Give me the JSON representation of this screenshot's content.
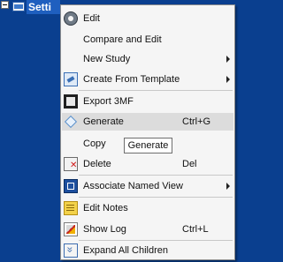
{
  "tree": {
    "node_label": "Setti"
  },
  "menu": {
    "items": [
      {
        "label": "Edit",
        "icon": "gear-icon"
      },
      {
        "label": "Compare and Edit"
      },
      {
        "label": "New Study",
        "submenu": true
      },
      {
        "label": "Create From Template",
        "icon": "template-icon",
        "submenu": true
      },
      {
        "label": "Export 3MF",
        "icon": "export-icon"
      },
      {
        "label": "Generate",
        "shortcut": "Ctrl+G",
        "icon": "generate-icon",
        "hovered": true
      },
      {
        "label": "Copy"
      },
      {
        "label": "Delete",
        "shortcut": "Del",
        "icon": "delete-icon"
      },
      {
        "label": "Associate Named View",
        "icon": "associate-view-icon",
        "submenu": true
      },
      {
        "label": "Edit Notes",
        "icon": "notes-icon"
      },
      {
        "label": "Show Log",
        "shortcut": "Ctrl+L",
        "icon": "log-icon"
      },
      {
        "label": "Expand All Children",
        "icon": "expand-all-icon"
      }
    ]
  },
  "tooltip": {
    "text": "Generate"
  },
  "colors": {
    "background": "#0a3f8f",
    "selection": "#1f5fbf",
    "menu_background": "#f5f5f5",
    "hover": "#dcdcdc"
  }
}
